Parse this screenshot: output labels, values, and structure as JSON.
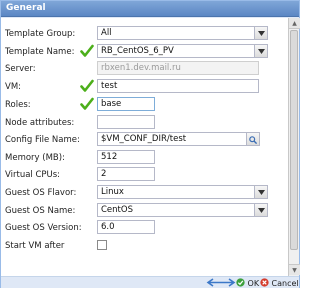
{
  "window": {
    "title": "General"
  },
  "fields": [
    {
      "label": "Template Group:",
      "value": "All",
      "type": "select",
      "check": false
    },
    {
      "label": "Template Name:",
      "value": "RB_CentOS_6_PV",
      "type": "select",
      "check": true
    },
    {
      "label": "Server:",
      "value": "rbxen1.dev.mail.ru",
      "type": "disabled",
      "check": false
    },
    {
      "label": "VM:",
      "value": "test",
      "type": "text",
      "check": true
    },
    {
      "label": "Roles:",
      "value": "base",
      "type": "text",
      "check": true
    },
    {
      "label": "Node attributes:",
      "value": "",
      "type": "text",
      "check": false
    },
    {
      "label": "Config File Name:",
      "value": "$VM_CONF_DIR/test",
      "type": "search",
      "check": false
    },
    {
      "label": "Memory (MB):",
      "value": "512",
      "type": "text",
      "check": false
    },
    {
      "label": "Virtual CPUs:",
      "value": "2",
      "type": "text",
      "check": false
    },
    {
      "label": "Guest OS Flavor:",
      "value": "Linux",
      "type": "select",
      "check": false
    },
    {
      "label": "Guest OS Name:",
      "value": "CentOS",
      "type": "select",
      "check": false
    },
    {
      "label": "Guest OS Version:",
      "value": "6.0",
      "type": "text",
      "check": false
    },
    {
      "label": "Start VM after",
      "value": "",
      "type": "checkbox",
      "check": false
    }
  ],
  "footer": {
    "ok_label": "OK",
    "cancel_label": "Cancel"
  },
  "colors": {
    "accent": "#5b87c4",
    "check": "#4caf1a"
  }
}
